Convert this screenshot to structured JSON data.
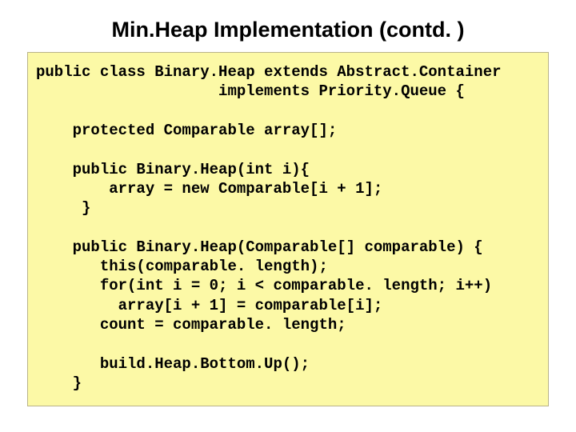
{
  "title": "Min.Heap Implementation (contd. )",
  "code": {
    "l01": "public class Binary.Heap extends Abstract.Container",
    "l02": "                    implements Priority.Queue {",
    "blank1": "",
    "l03": "    protected Comparable array[];",
    "blank2": "",
    "l04": "    public Binary.Heap(int i){",
    "l05": "        array = new Comparable[i + 1];",
    "l06": "     }",
    "blank3": "",
    "l07": "    public Binary.Heap(Comparable[] comparable) {",
    "l08": "       this(comparable. length);",
    "l09": "       for(int i = 0; i < comparable. length; i++)",
    "l10": "         array[i + 1] = comparable[i];",
    "l11": "       count = comparable. length;",
    "blank4": "",
    "l12": "       build.Heap.Bottom.Up();",
    "l13": "    }"
  }
}
